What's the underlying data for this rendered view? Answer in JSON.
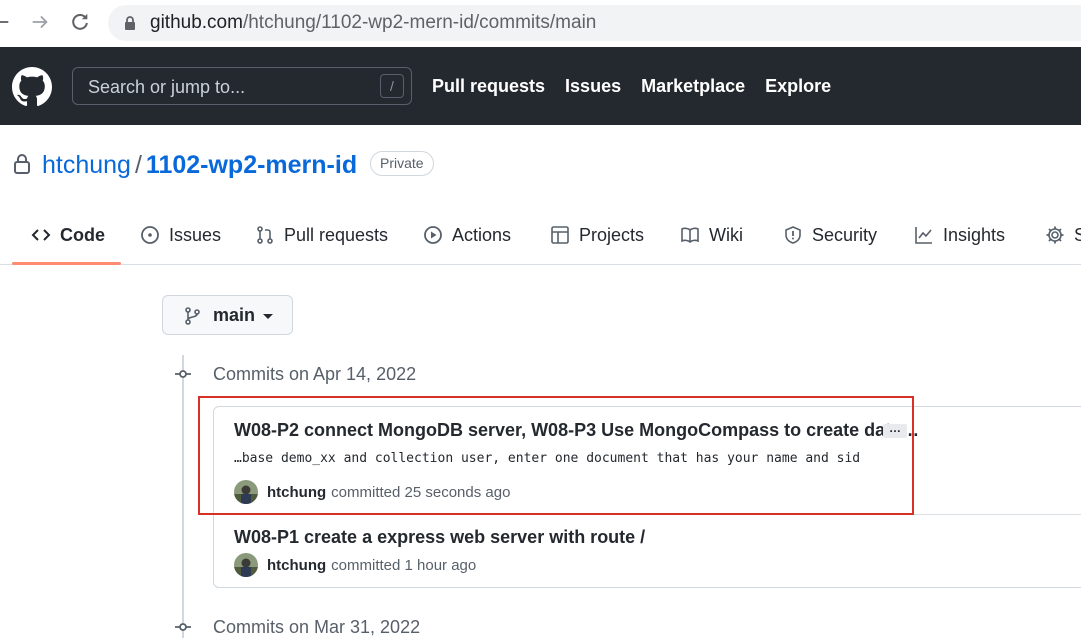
{
  "browser": {
    "url_host": "github.com",
    "url_path": "/htchung/1102-wp2-mern-id/commits/main"
  },
  "header": {
    "search_placeholder": "Search or jump to...",
    "search_shortcut": "/",
    "nav": [
      "Pull requests",
      "Issues",
      "Marketplace",
      "Explore"
    ]
  },
  "repo": {
    "owner": "htchung",
    "separator": "/",
    "name": "1102-wp2-mern-id",
    "visibility": "Private"
  },
  "tabs": [
    {
      "label": "Code",
      "icon": "code-icon",
      "selected": true
    },
    {
      "label": "Issues",
      "icon": "issue-icon"
    },
    {
      "label": "Pull requests",
      "icon": "pull-request-icon"
    },
    {
      "label": "Actions",
      "icon": "play-icon"
    },
    {
      "label": "Projects",
      "icon": "table-icon"
    },
    {
      "label": "Wiki",
      "icon": "book-icon"
    },
    {
      "label": "Security",
      "icon": "shield-icon"
    },
    {
      "label": "Insights",
      "icon": "graph-icon"
    },
    {
      "label": "S",
      "icon": "gear-icon"
    }
  ],
  "branch": {
    "name": "main"
  },
  "commit_groups": [
    {
      "heading": "Commits on Apr 14, 2022",
      "commits": [
        {
          "title": "W08-P2 connect MongoDB server, W08-P3 Use MongoCompass to create data…",
          "ellipsis": "…",
          "description": "…base demo_xx and collection user, enter one document that has your name and sid",
          "author": "htchung",
          "action": "committed 25 seconds ago"
        },
        {
          "title": "W08-P1 create a express web server with route /",
          "author": "htchung",
          "action": "committed 1 hour ago"
        }
      ]
    },
    {
      "heading": "Commits on Mar 31, 2022",
      "commits": []
    }
  ],
  "colors": {
    "header_bg": "#24292f",
    "link_blue": "#0969da",
    "tab_underline": "#fd8c73",
    "highlight_red": "#d93025"
  }
}
